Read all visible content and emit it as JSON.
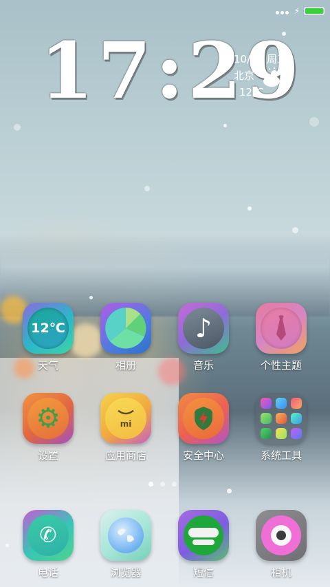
{
  "status_bar": {
    "signal": "signal-dots",
    "charging": "bolt-icon",
    "battery_color": "#3cd23c"
  },
  "clock": {
    "time": "17:29"
  },
  "date_widget": {
    "date": "10/26 周三",
    "city": "北京",
    "temp": "12℃",
    "icon": "cloud-sun-icon"
  },
  "apps": [
    {
      "label": "天气",
      "icon": "weather-icon",
      "badge": "12℃"
    },
    {
      "label": "相册",
      "icon": "gallery-icon"
    },
    {
      "label": "音乐",
      "icon": "music-icon"
    },
    {
      "label": "个性主题",
      "icon": "theme-tie-icon"
    },
    {
      "label": "设置",
      "icon": "gear-icon"
    },
    {
      "label": "应用商店",
      "icon": "app-store-icon",
      "badge": "mi"
    },
    {
      "label": "安全中心",
      "icon": "shield-icon"
    },
    {
      "label": "系统工具",
      "icon": "folder-icon"
    }
  ],
  "pager": {
    "pages": 3,
    "current": 1
  },
  "dock": [
    {
      "label": "电话",
      "icon": "phone-icon"
    },
    {
      "label": "浏览器",
      "icon": "globe-icon"
    },
    {
      "label": "短信",
      "icon": "message-icon"
    },
    {
      "label": "相机",
      "icon": "camera-icon"
    }
  ]
}
